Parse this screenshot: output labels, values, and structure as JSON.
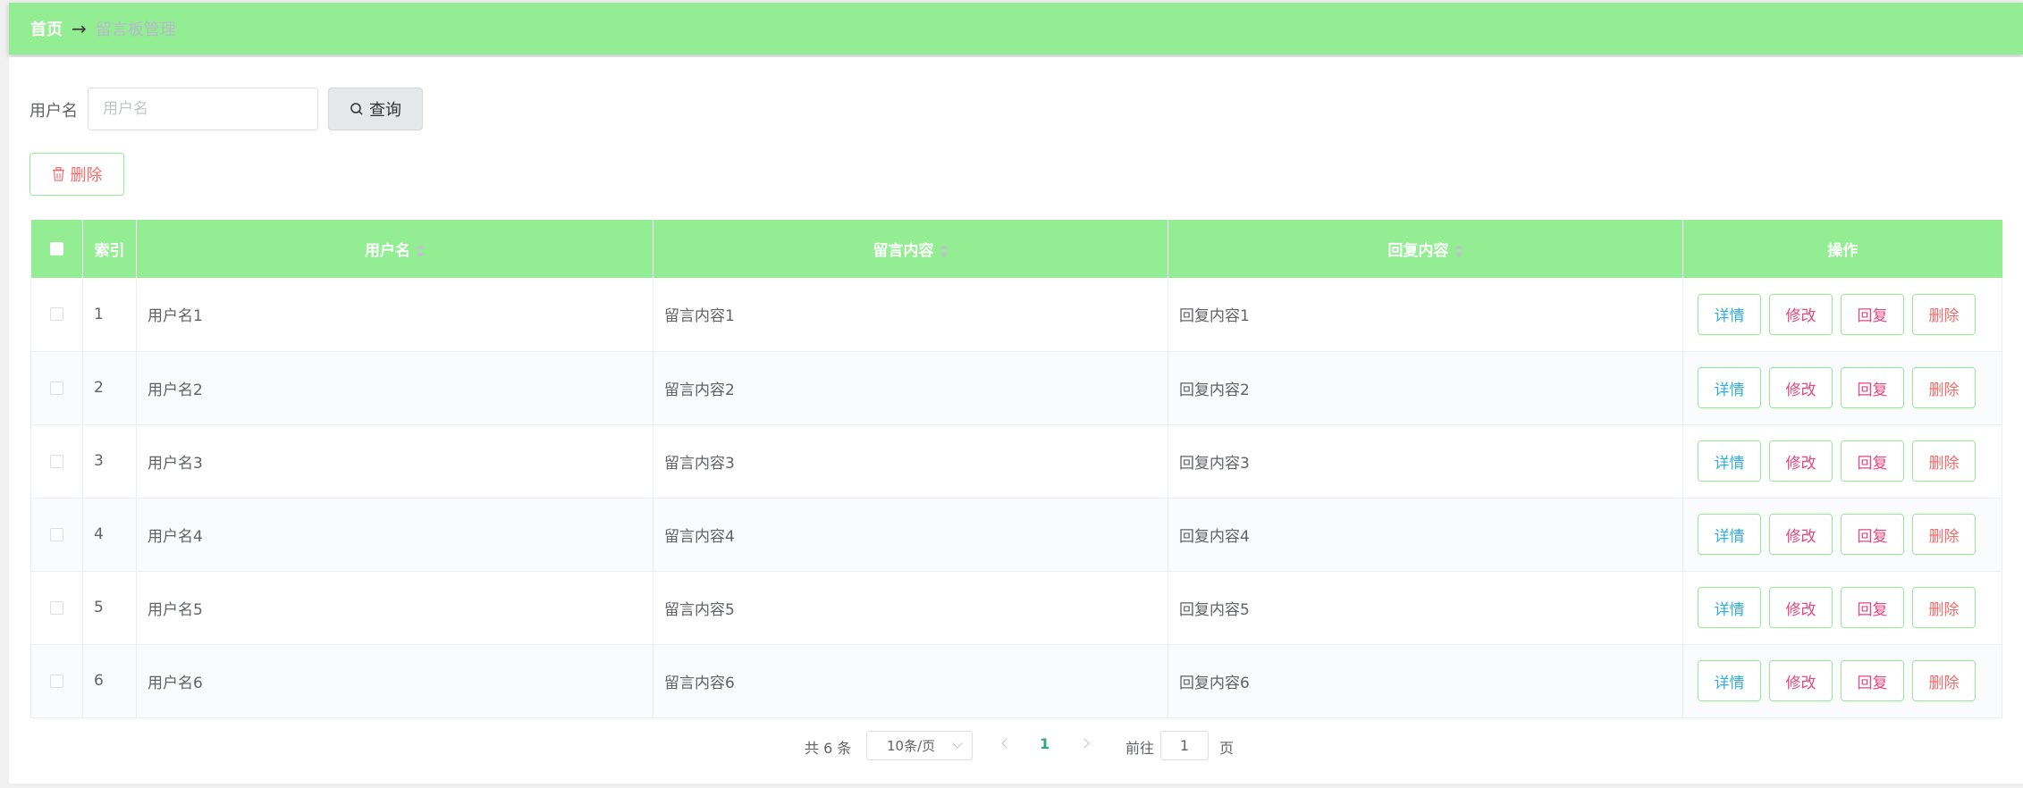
{
  "breadcrumb": {
    "home": "首页",
    "separator": "→",
    "current": "留言板管理"
  },
  "search": {
    "label": "用户名",
    "placeholder": "用户名",
    "value": "",
    "query_label": "查询"
  },
  "toolbar": {
    "delete_label": "删除"
  },
  "table": {
    "headers": {
      "index": "索引",
      "username": "用户名",
      "message": "留言内容",
      "reply": "回复内容",
      "actions": "操作"
    },
    "actions": {
      "detail": "详情",
      "edit": "修改",
      "reply": "回复",
      "delete": "删除"
    },
    "rows": [
      {
        "index": "1",
        "username": "用户名1",
        "message": "留言内容1",
        "reply": "回复内容1"
      },
      {
        "index": "2",
        "username": "用户名2",
        "message": "留言内容2",
        "reply": "回复内容2"
      },
      {
        "index": "3",
        "username": "用户名3",
        "message": "留言内容3",
        "reply": "回复内容3"
      },
      {
        "index": "4",
        "username": "用户名4",
        "message": "留言内容4",
        "reply": "回复内容4"
      },
      {
        "index": "5",
        "username": "用户名5",
        "message": "留言内容5",
        "reply": "回复内容5"
      },
      {
        "index": "6",
        "username": "用户名6",
        "message": "留言内容6",
        "reply": "回复内容6"
      }
    ]
  },
  "pagination": {
    "total": "共 6 条",
    "page_size": "10条/页",
    "current_page": "1",
    "goto_label": "前往",
    "goto_value": "1",
    "page_unit": "页"
  },
  "colors": {
    "header_bg": "#93ee93",
    "danger": "#f56c6c",
    "detail": "#31aee0",
    "edit": "#e3477f",
    "active_page": "#2fa87b"
  }
}
